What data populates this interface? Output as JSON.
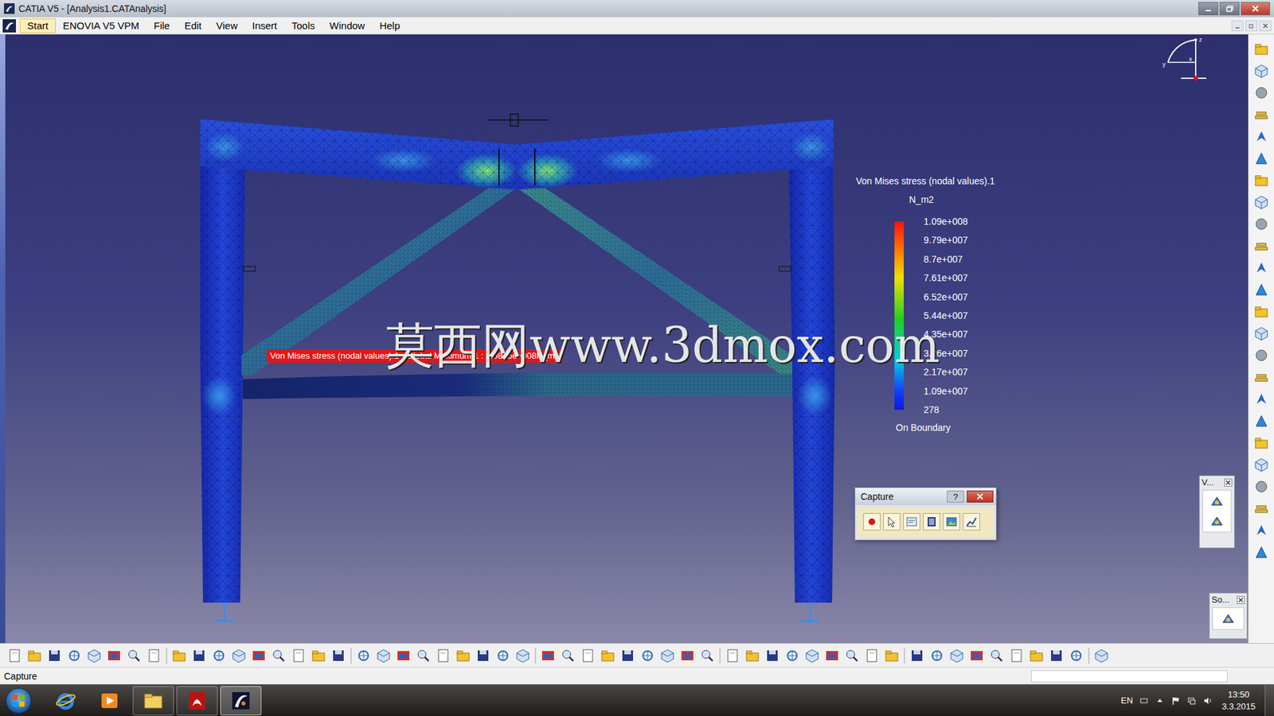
{
  "window": {
    "title": "CATIA V5 - [Analysis1.CATAnalysis]"
  },
  "menu": [
    {
      "label": "Start",
      "selected": true
    },
    {
      "label": "ENOVIA V5 VPM",
      "selected": false
    },
    {
      "label": "File",
      "selected": false
    },
    {
      "label": "Edit",
      "selected": false
    },
    {
      "label": "View",
      "selected": false
    },
    {
      "label": "Insert",
      "selected": false
    },
    {
      "label": "Tools",
      "selected": false
    },
    {
      "label": "Window",
      "selected": false
    },
    {
      "label": "Help",
      "selected": false
    }
  ],
  "compass": {
    "axes": [
      "z",
      "x",
      "y"
    ]
  },
  "legend": {
    "title": "Von Mises stress (nodal values).1",
    "unit": "N_m2",
    "values": [
      "1.09e+008",
      "9.79e+007",
      "8.7e+007",
      "7.61e+007",
      "6.52e+007",
      "5.44e+007",
      "4.35e+007",
      "3.26e+007",
      "2.17e+007",
      "1.09e+007",
      "278"
    ],
    "footer": "On Boundary"
  },
  "tooltip": {
    "text": "Von Mises stress (nodal values).1 - Global Maximum.1 : 1.0835e+008N_m2"
  },
  "watermark": {
    "text": "莫西网www.3dmox.com"
  },
  "capture_panel": {
    "title": "Capture",
    "help": "?"
  },
  "mini_toolbars": [
    {
      "title": "V..."
    },
    {
      "title": "So..."
    }
  ],
  "status_bar": {
    "text": "Capture"
  },
  "taskbar": {
    "language": "EN",
    "time": "13:50",
    "date": "3.3.2015",
    "apps": [
      {
        "kind": "browser",
        "running": false,
        "selected": false
      },
      {
        "kind": "media",
        "running": false,
        "selected": false
      },
      {
        "kind": "folder",
        "running": true,
        "selected": false
      },
      {
        "kind": "pdf",
        "running": true,
        "selected": false
      },
      {
        "kind": "catia",
        "running": true,
        "selected": true
      }
    ]
  }
}
